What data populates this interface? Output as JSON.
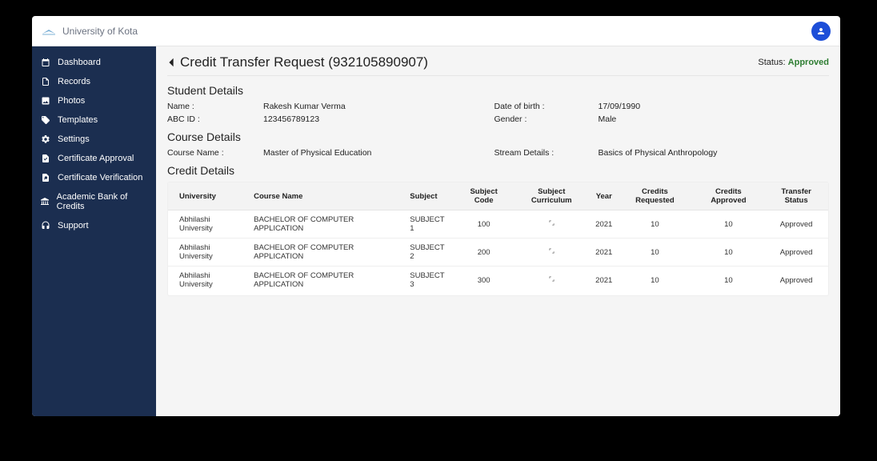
{
  "brand": {
    "name": "University of Kota"
  },
  "sidebar": {
    "items": [
      {
        "label": "Dashboard"
      },
      {
        "label": "Records"
      },
      {
        "label": "Photos"
      },
      {
        "label": "Templates"
      },
      {
        "label": "Settings"
      },
      {
        "label": "Certificate Approval"
      },
      {
        "label": "Certificate Verification"
      },
      {
        "label": "Academic Bank of Credits"
      },
      {
        "label": "Support"
      }
    ]
  },
  "page": {
    "title": "Credit Transfer Request (932105890907)",
    "status_label": "Status: ",
    "status_value": "Approved"
  },
  "student_details": {
    "header": "Student Details",
    "name_label": "Name :",
    "name_value": "Rakesh Kumar Verma",
    "dob_label": "Date of birth :",
    "dob_value": "17/09/1990",
    "abcid_label": "ABC ID :",
    "abcid_value": "123456789123",
    "gender_label": "Gender :",
    "gender_value": "Male"
  },
  "course_details": {
    "header": "Course Details",
    "course_name_label": "Course Name :",
    "course_name_value": "Master of Physical Education",
    "stream_label": "Stream Details :",
    "stream_value": "Basics of Physical Anthropology"
  },
  "credit_details": {
    "header": "Credit Details",
    "columns": {
      "university": "University",
      "course_name": "Course Name",
      "subject": "Subject",
      "subject_code": "Subject Code",
      "subject_curriculum": "Subject Curriculum",
      "year": "Year",
      "credits_requested": "Credits Requested",
      "credits_approved": "Credits Approved",
      "transfer_status": "Transfer Status"
    },
    "rows": [
      {
        "university": "Abhilashi University",
        "course_name": "BACHELOR OF COMPUTER APPLICATION",
        "subject": "SUBJECT 1",
        "subject_code": "100",
        "year": "2021",
        "credits_requested": "10",
        "credits_approved": "10",
        "transfer_status": "Approved"
      },
      {
        "university": "Abhilashi University",
        "course_name": "BACHELOR OF COMPUTER APPLICATION",
        "subject": "SUBJECT 2",
        "subject_code": "200",
        "year": "2021",
        "credits_requested": "10",
        "credits_approved": "10",
        "transfer_status": "Approved"
      },
      {
        "university": "Abhilashi University",
        "course_name": "BACHELOR OF COMPUTER APPLICATION",
        "subject": "SUBJECT 3",
        "subject_code": "300",
        "year": "2021",
        "credits_requested": "10",
        "credits_approved": "10",
        "transfer_status": "Approved"
      }
    ]
  }
}
